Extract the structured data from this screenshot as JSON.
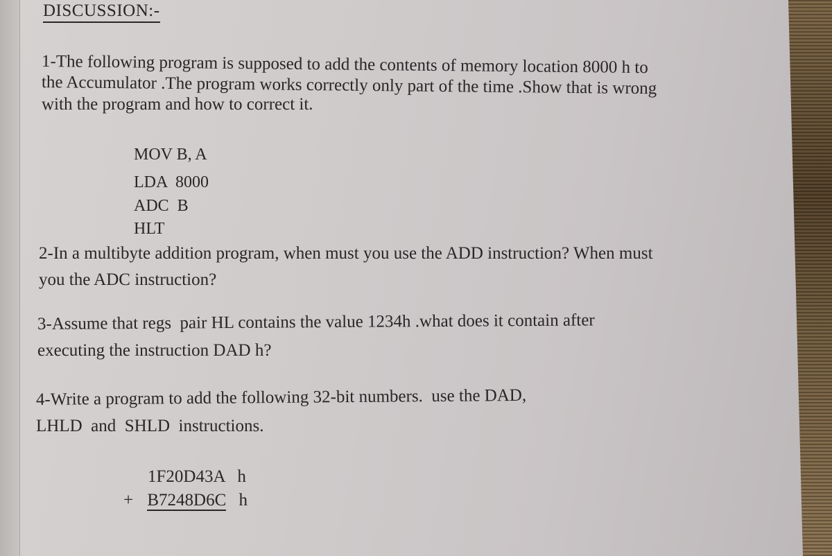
{
  "heading": "DISCUSSION:-",
  "questions": [
    {
      "lines": [
        "1-The following program is supposed to add the contents of memory location 8000 h to",
        "the Accumulator .The program works correctly only part of the time .Show that is wrong",
        "with the program and how to correct it."
      ],
      "code": [
        "MOV B, A",
        "LDA  8000",
        "ADC  B",
        "HLT"
      ]
    },
    {
      "lines": [
        "2-In a multibyte addition program, when must you use the ADD instruction? When must",
        "you the ADC instruction?"
      ]
    },
    {
      "lines": [
        "3-Assume that regs  pair HL contains the value 1234h .what does it contain after",
        "executing the instruction DAD h?"
      ]
    },
    {
      "lines": [
        "4-Write a program to add the following 32-bit numbers.  use the DAD,",
        "LHLD  and  SHLD  instructions."
      ],
      "addition": {
        "operand1": "1F20D43A",
        "operator": "+",
        "operand2": "B7248D6C",
        "suffix": "h"
      }
    }
  ]
}
